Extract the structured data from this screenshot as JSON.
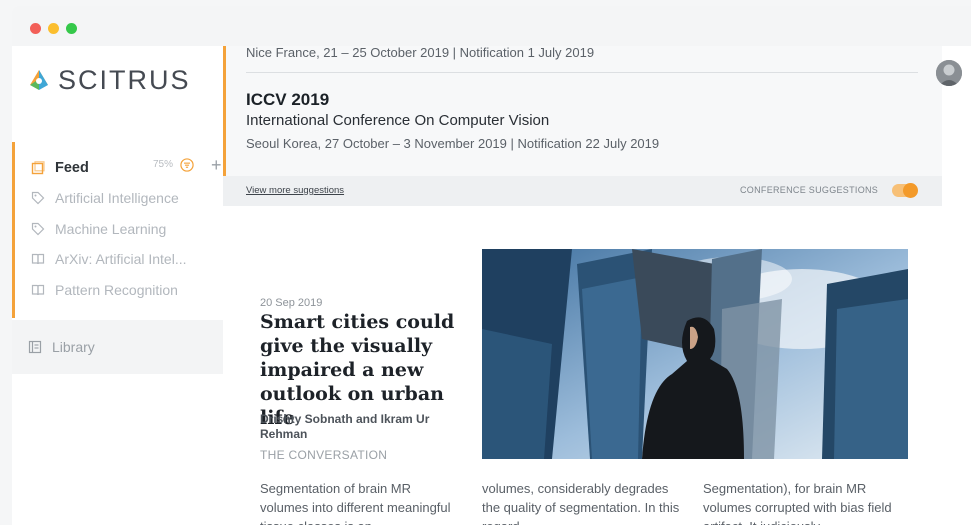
{
  "brand": {
    "name": "SCITRUS"
  },
  "sidebar": {
    "feed": {
      "label": "Feed",
      "percent": "75%"
    },
    "topics": [
      {
        "label": "Artificial Intelligence",
        "icon": "tag-icon"
      },
      {
        "label": "Machine Learning",
        "icon": "tag-icon"
      },
      {
        "label": "ArXiv: Artificial Intel...",
        "icon": "book-icon"
      },
      {
        "label": "Pattern Recognition",
        "icon": "book-icon"
      }
    ],
    "library": {
      "label": "Library"
    }
  },
  "conferences": [
    {
      "location_dates": "Nice France, 21 – 25 October 2019 | Notification 1 July 2019"
    },
    {
      "title": "ICCV 2019",
      "full_name": "International Conference On Computer Vision",
      "location_dates": "Seoul Korea, 27 October – 3 November 2019 | Notification 22 July 2019"
    }
  ],
  "suggestions": {
    "view_more": "View more suggestions",
    "label": "CONFERENCE SUGGESTIONS",
    "enabled": true
  },
  "article": {
    "date": "20 Sep 2019",
    "title": "Smart cities could give the visually impaired a new outlook on urban life",
    "authors": "Drishty Sobnath and Ikram Ur Rehman",
    "source": "THE CONVERSATION",
    "columns": [
      "Segmentation of brain MR volumes into different meaningful tissue classes is an",
      "volumes, considerably degrades the quality of segmentation. In this regard",
      "Segmentation), for brain MR volumes corrupted with bias field artifact. It judiciously"
    ]
  },
  "colors": {
    "accent": "#f4a23a",
    "toggle_on": "#f39a2a"
  }
}
